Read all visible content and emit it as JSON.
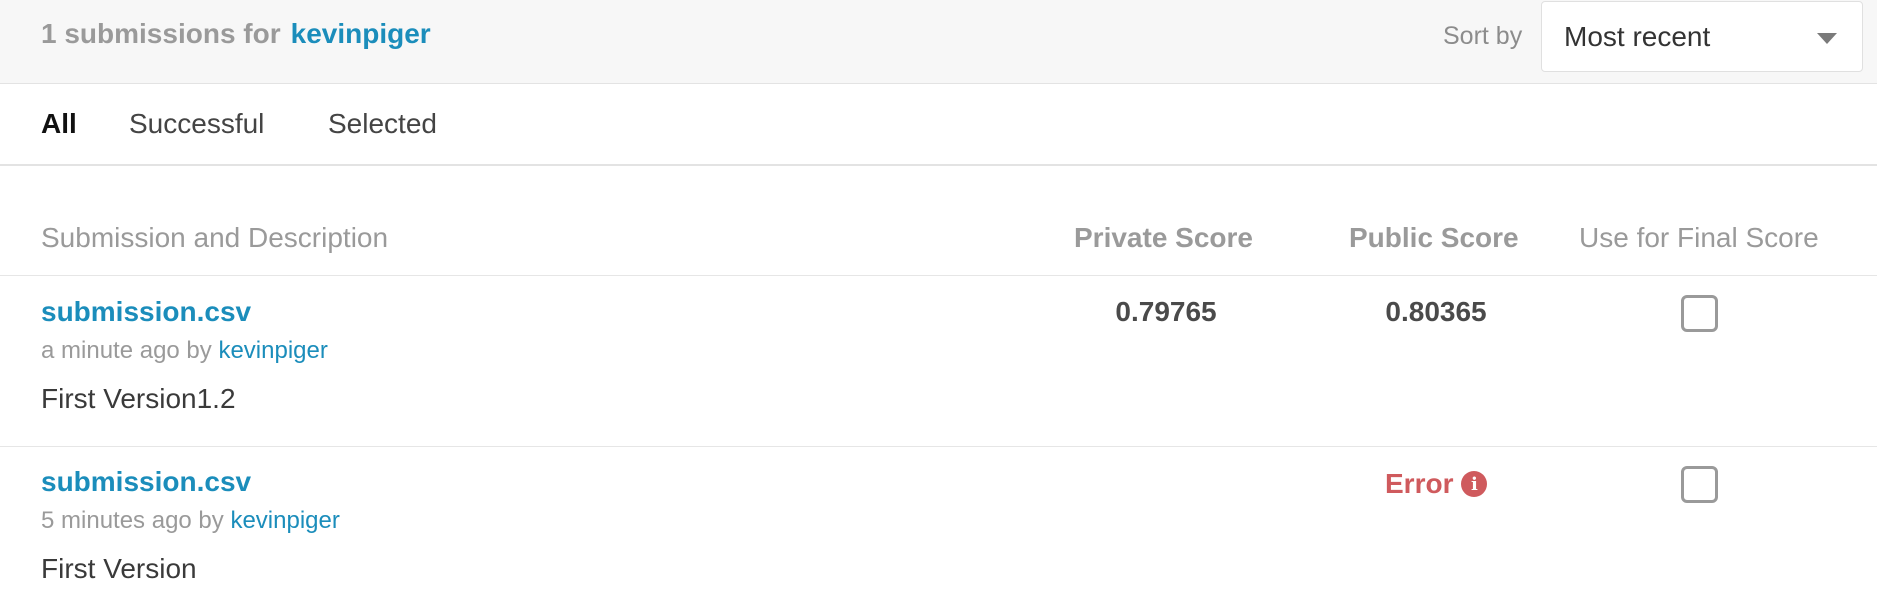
{
  "header": {
    "count_text": "1 submissions for",
    "username": "kevinpiger",
    "sort_label": "Sort by",
    "sort_value": "Most recent"
  },
  "tabs": [
    {
      "label": "All",
      "active": true
    },
    {
      "label": "Successful",
      "active": false
    },
    {
      "label": "Selected",
      "active": false
    }
  ],
  "table": {
    "columns": {
      "submission": "Submission and Description",
      "private": "Private Score",
      "public": "Public Score",
      "final": "Use for Final Score"
    },
    "rows": [
      {
        "file": "submission.csv",
        "time": "a minute ago by",
        "user": "kevinpiger",
        "description": "First Version1.2",
        "private_score": "0.79765",
        "public_score": "0.80365",
        "selected": false
      },
      {
        "file": "submission.csv",
        "time": "5 minutes ago by",
        "user": "kevinpiger",
        "description": "First Version",
        "private_score": "",
        "public_score": "Error",
        "selected": false
      }
    ]
  },
  "colors": {
    "link": "#1b8dbb",
    "error": "#cf5a5d",
    "header_bg": "#f7f7f7"
  },
  "icons": {
    "error_info": "info-icon",
    "sort_caret": "caret-down-icon"
  }
}
